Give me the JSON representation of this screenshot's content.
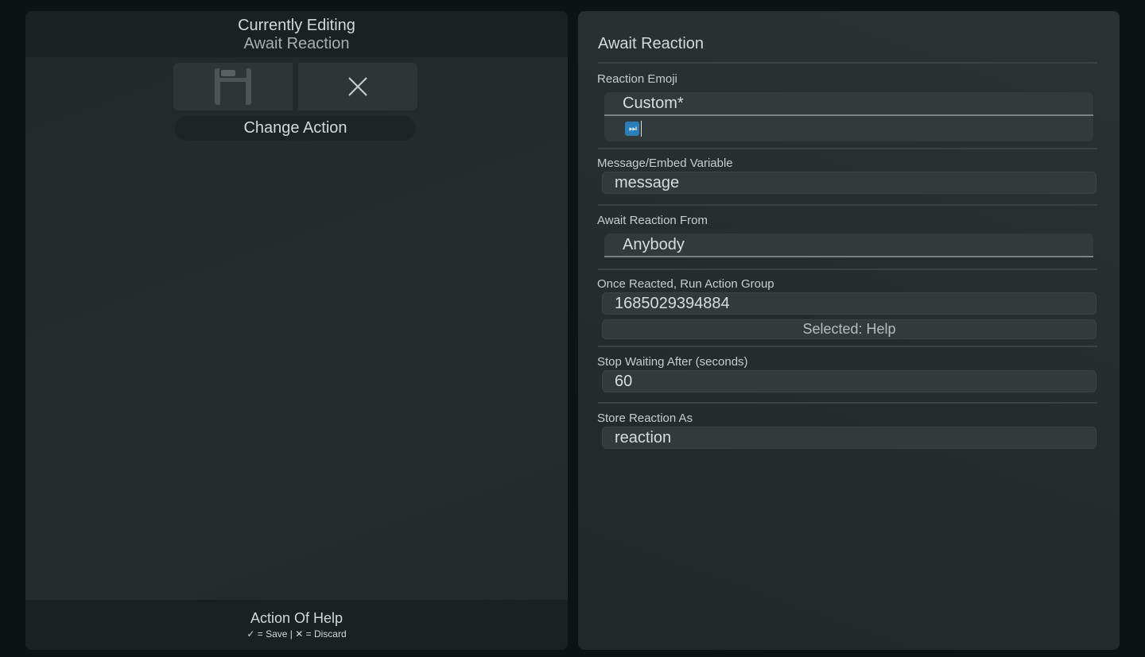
{
  "editor": {
    "heading": "Currently Editing",
    "action_name": "Await Reaction",
    "change_action_label": "Change Action",
    "footer_title": "Action Of Help",
    "footer_hint": "✓ = Save | ✕ = Discard"
  },
  "icons": {
    "save": "floppy-disk-icon",
    "discard": "close-icon",
    "emoji": "fast-forward-emoji"
  },
  "form": {
    "title": "Await Reaction",
    "reaction_emoji": {
      "label": "Reaction Emoji",
      "mode": "Custom*",
      "value": "⏭"
    },
    "message_variable": {
      "label": "Message/Embed Variable",
      "value": "message"
    },
    "reaction_from": {
      "label": "Await Reaction From",
      "value": "Anybody"
    },
    "action_group": {
      "label": "Once Reacted, Run Action Group",
      "value": "1685029394884",
      "selected": "Selected: Help"
    },
    "stop_after": {
      "label": "Stop Waiting After (seconds)",
      "value": "60"
    },
    "store_as": {
      "label": "Store Reaction As",
      "value": "reaction"
    }
  },
  "colors": {
    "background": "#0d1213",
    "panel": "#262c2d",
    "field": "#343a3b",
    "emoji_blue": "#2a7fb8"
  }
}
